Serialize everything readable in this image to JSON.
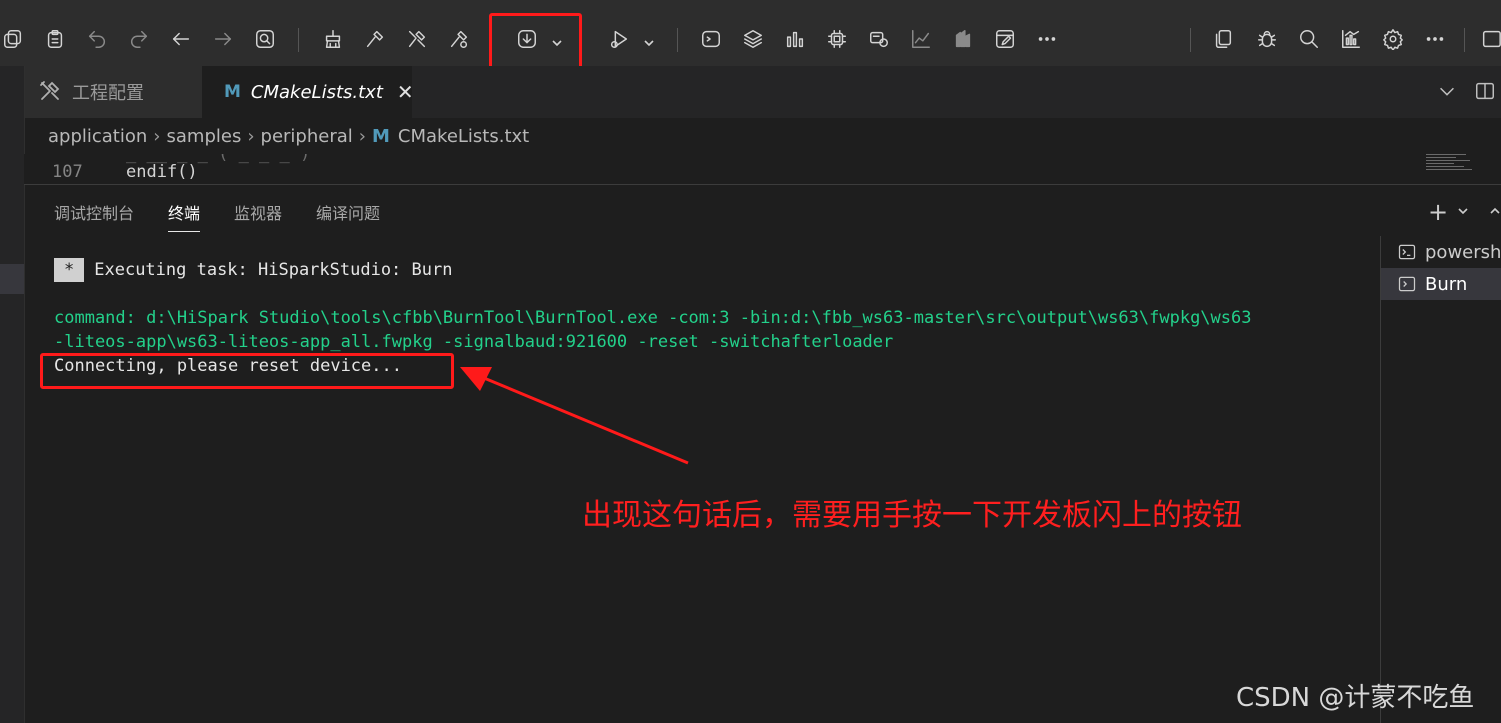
{
  "toolbar": {
    "icons": [
      "copy-icon",
      "paste-icon",
      "undo-icon",
      "redo-icon",
      "back-arrow-icon",
      "forward-arrow-icon",
      "search-file-icon",
      "clean-icon",
      "build-icon",
      "rebuild-icon",
      "stop-build-icon",
      "burn-download-icon",
      "debug-run-icon",
      "terminal-icon",
      "layers-icon",
      "bar-chart-icon",
      "chip-icon",
      "monitor-icon",
      "line-chart-icon",
      "stack-icon",
      "edit-window-icon",
      "more-icon",
      "copy-window-icon",
      "bug-icon",
      "search-icon",
      "analytics-icon",
      "settings-icon",
      "more-icon-2",
      "window-icon"
    ]
  },
  "tabs": [
    {
      "label": "工程配置",
      "active": false
    },
    {
      "label": "CMakeLists.txt",
      "active": true,
      "icon_letter": "M"
    }
  ],
  "breadcrumb": {
    "items": [
      "application",
      "samples",
      "peripheral"
    ],
    "file": "CMakeLists.txt",
    "file_icon_letter": "M"
  },
  "editor": {
    "line_number": "107",
    "code": "endif()"
  },
  "panel": {
    "tabs": [
      "调试控制台",
      "终端",
      "监视器",
      "编译问题"
    ],
    "active_tab": "终端"
  },
  "terminal": {
    "task_marker": "*",
    "task_line": "Executing task: HiSparkStudio: Burn",
    "command_line1": "command: d:\\HiSpark Studio\\tools\\cfbb\\BurnTool\\BurnTool.exe -com:3 -bin:d:\\fbb_ws63-master\\src\\output\\ws63\\fwpkg\\ws63",
    "command_line2": "-liteos-app\\ws63-liteos-app_all.fwpkg -signalbaud:921600 -reset -switchafterloader",
    "status_line": "Connecting, please reset device..."
  },
  "terminal_list": [
    {
      "label": "powershell",
      "selected": false
    },
    {
      "label": "Burn",
      "selected": true
    }
  ],
  "annotation": {
    "text": "出现这句话后，需要用手按一下开发板闪上的按钮",
    "color": "#ff1f1f"
  },
  "watermark": "CSDN @计蒙不吃鱼",
  "colors": {
    "highlight_box": "#ff1a1a",
    "terminal_green": "#23d18b",
    "cmake_icon": "#519aba"
  }
}
